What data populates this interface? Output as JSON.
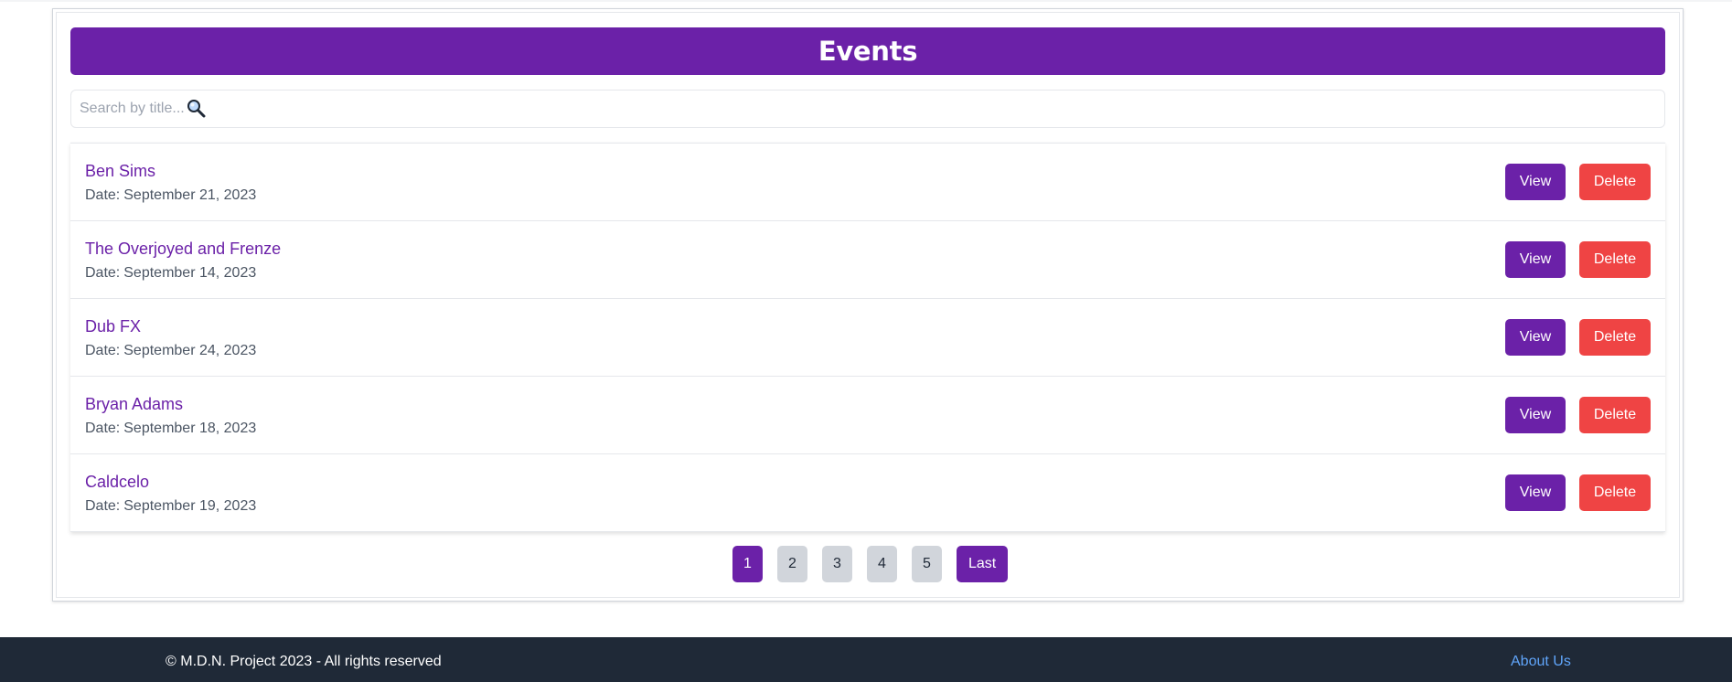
{
  "header": {
    "title": "Events"
  },
  "search": {
    "placeholder": "Search by title..."
  },
  "events": [
    {
      "title": "Ben Sims",
      "date_label": "Date:",
      "date": "September 21, 2023",
      "view_label": "View",
      "delete_label": "Delete"
    },
    {
      "title": "The Overjoyed and Frenze",
      "date_label": "Date:",
      "date": "September 14, 2023",
      "view_label": "View",
      "delete_label": "Delete"
    },
    {
      "title": "Dub FX",
      "date_label": "Date:",
      "date": "September 24, 2023",
      "view_label": "View",
      "delete_label": "Delete"
    },
    {
      "title": "Bryan Adams",
      "date_label": "Date:",
      "date": "September 18, 2023",
      "view_label": "View",
      "delete_label": "Delete"
    },
    {
      "title": "Caldcelo",
      "date_label": "Date:",
      "date": "September 19, 2023",
      "view_label": "View",
      "delete_label": "Delete"
    }
  ],
  "pagination": {
    "pages": [
      "1",
      "2",
      "3",
      "4",
      "5"
    ],
    "current": "1",
    "last_label": "Last"
  },
  "footer": {
    "copyright": "© M.D.N. Project 2023 - All rights reserved",
    "about_label": "About Us"
  },
  "colors": {
    "primary": "#6b21a8",
    "danger": "#ef4444",
    "footer_bg": "#1f2937",
    "link": "#60a5fa"
  }
}
